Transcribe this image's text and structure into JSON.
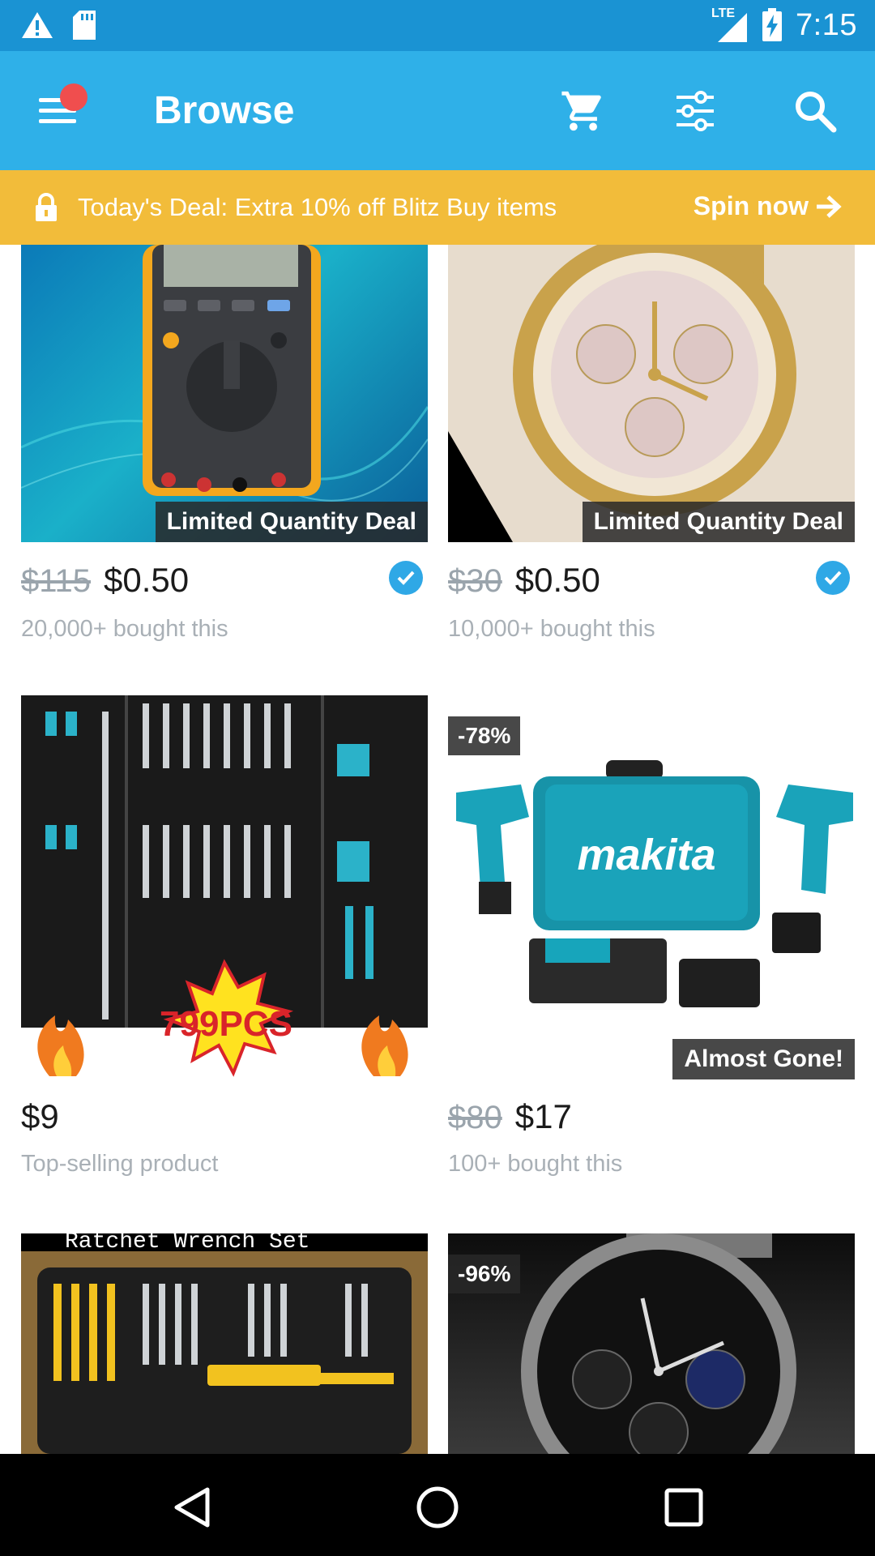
{
  "status_bar": {
    "network": "LTE",
    "time": "7:15"
  },
  "app_bar": {
    "title": "Browse"
  },
  "deal_banner": {
    "text": "Today's Deal: Extra 10% off Blitz Buy items",
    "cta": "Spin now"
  },
  "products": [
    {
      "badge": "Limited Quantity Deal",
      "old_price": "$115",
      "price": "$0.50",
      "sub": "20,000+ bought this",
      "verified": true,
      "image": "multimeter-image"
    },
    {
      "badge": "Limited Quantity Deal",
      "old_price": "$30",
      "price": "$0.50",
      "sub": "10,000+ bought this",
      "verified": true,
      "image": "gold-watch-image"
    },
    {
      "burst": "799PCS",
      "price": "$9",
      "sub": "Top-selling product",
      "image": "tool-set-image"
    },
    {
      "discount": "-78%",
      "brand": "makita",
      "badge": "Almost Gone!",
      "old_price": "$80",
      "price": "$17",
      "sub": "100+ bought this",
      "image": "drill-kit-image"
    },
    {
      "caption": "Ratchet Wrench Set",
      "image": "wrench-set-image"
    },
    {
      "discount": "-96%",
      "image": "black-watch-image"
    }
  ],
  "colors": {
    "status_bar": "#1a93d3",
    "app_bar": "#2fb0e8",
    "deal_banner": "#f2bc3a",
    "notification_dot": "#f04e4e",
    "verified": "#2fa8e6"
  }
}
